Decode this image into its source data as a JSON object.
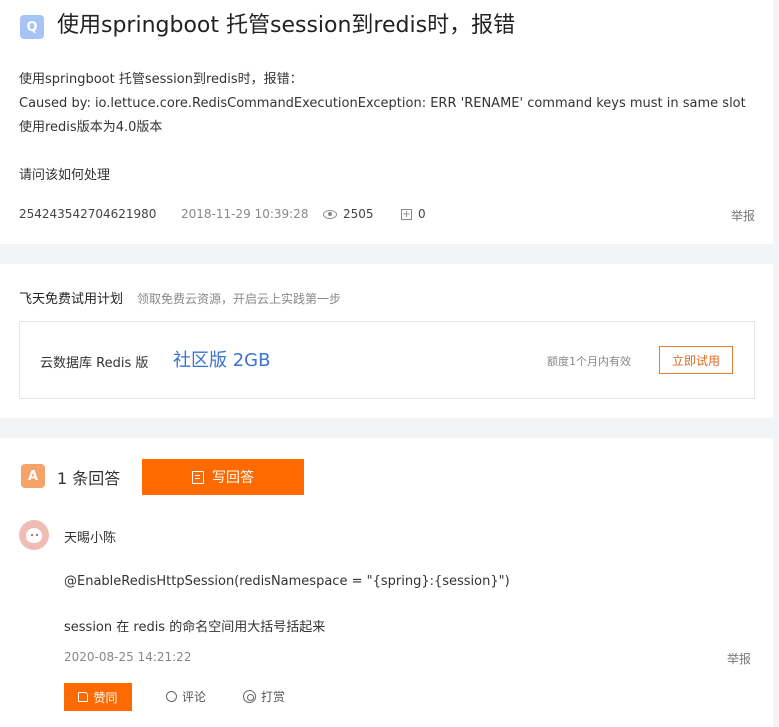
{
  "question": {
    "badge": "Q",
    "title": "使用springboot 托管session到redis时，报错",
    "body_lines": [
      "使用springboot 托管session到redis时，报错：",
      "Caused by: io.lettuce.core.RedisCommandExecutionException: ERR 'RENAME' command keys must in same slot",
      "使用redis版本为4.0版本",
      "",
      "请问该如何处理"
    ],
    "user_id": "254243542704621980",
    "date": "2018-11-29 10:39:28",
    "views": "2505",
    "collects": "0",
    "report_label": "举报"
  },
  "promo": {
    "title": "飞天免费试用计划",
    "subtitle": "领取免费云资源，开启云上实践第一步",
    "product": "云数据库 Redis 版",
    "spec": "社区版 2GB",
    "quota": "额度1个月内有效",
    "button_label": "立即试用"
  },
  "answers": {
    "badge": "A",
    "count_label": "1 条回答",
    "write_button_label": "写回答",
    "items": [
      {
        "user": "天晹小陈",
        "line1": "@EnableRedisHttpSession(redisNamespace = \"{spring}:{session}\")",
        "line2": "session 在 redis 的命名空间用大括号括起来",
        "date": "2020-08-25 14:21:22",
        "report_label": "举报",
        "like_label": "赞同",
        "comment_label": "评论",
        "tip_label": "打赏"
      }
    ]
  },
  "colors": {
    "accent": "#ff6a00",
    "link_blue": "#3b73cf",
    "q_badge": "#a8c4f6",
    "a_badge": "#f6a26b"
  }
}
